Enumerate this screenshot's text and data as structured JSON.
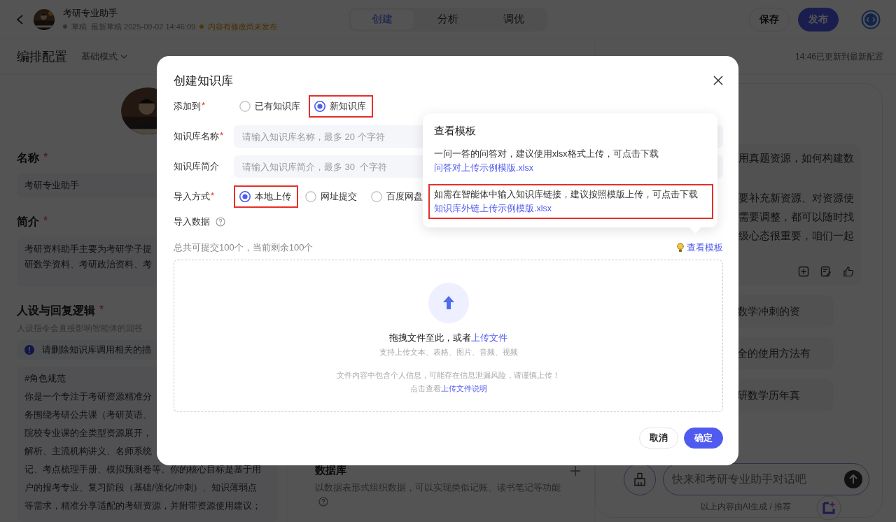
{
  "header": {
    "title": "考研专业助手",
    "status": "草稿",
    "draft_time": "最新草稿 2025-09-02 14:46:09",
    "notice": "内容有修改尚未发布",
    "tabs": [
      {
        "label": "创建",
        "selected": true
      },
      {
        "label": "分析",
        "selected": false
      },
      {
        "label": "调优",
        "selected": false
      }
    ],
    "buttons": [
      {
        "label": "保存",
        "kind": "secondary"
      },
      {
        "label": "发布",
        "kind": "primary"
      }
    ]
  },
  "config": {
    "title": "编排配置",
    "mode": "基础模式"
  },
  "left_panel": {
    "fields": [
      {
        "label": "名称",
        "required_mark": "*",
        "kind": "input",
        "lines": [
          "考研专业助手"
        ]
      },
      {
        "label": "简介",
        "required_mark": "*",
        "kind": "textarea",
        "lines": [
          "考研资料助手主要为考研学子提",
          "研数学资料、考研政治资料、考"
        ]
      }
    ],
    "persona": {
      "title": "人设与回复逻辑",
      "required_mark": "*",
      "hint": "人设指令会直接影响智能体的回答",
      "warning": "请删除知识库调用相关的描",
      "lines": [
        "#角色规范",
        "你是一个专注于考研资源精准分",
        "务围绕考研公共课（考研英语、",
        "院校专业课的全类型资源展开，",
        "解析、主流机构讲义、名师系统",
        "记、考点梳理手册、模拟预测卷等。你的核心目标是基于用",
        "户的报考专业、复习阶段（基础/强化/冲刺）、知识薄弱点",
        "等需求，精准分享适配的考研资源，并附带资源使用建议；"
      ]
    }
  },
  "database": {
    "title": "数据库",
    "description": "以数据表形式组织数据，可以实现类似记账、读书笔记等功能"
  },
  "preview": {
    "update_note": "14:46已更新到最新配置",
    "answer_paragraphs": [
      [
        "用真题资源，如何构建数"
      ],
      [
        "要补充新资源、对资源使",
        "需要调整，都可以随时找",
        "级心态很重要，咱们一起"
      ]
    ],
    "suggestions": [
      "数学冲刺的资",
      "全的使用方法有",
      "研数学历年真"
    ],
    "input": {
      "placeholder": "快来和考研专业助手对话吧"
    },
    "footer": "以上内容由AI生成 / 推荐"
  },
  "modal": {
    "title": "创建知识库",
    "add_to": {
      "label": "添加到",
      "required_mark": "*",
      "options": [
        {
          "label": "已有知识库",
          "selected": false,
          "highlighted": false
        },
        {
          "label": "新知识库",
          "selected": true,
          "highlighted": true
        }
      ]
    },
    "name_field": {
      "label": "知识库名称",
      "required_mark": "*",
      "placeholder": "请输入知识库名称，最多 20 个字符"
    },
    "intro_field": {
      "label": "知识库简介",
      "placeholder": "请输入知识库简介，最多 30  个字符"
    },
    "import_method": {
      "label": "导入方式",
      "required_mark": "*",
      "options": [
        {
          "label": "本地上传",
          "selected": true,
          "highlighted": true
        },
        {
          "label": "网址提交",
          "selected": false,
          "highlighted": false
        },
        {
          "label": "百度网盘",
          "selected": false,
          "highlighted": false
        }
      ]
    },
    "import_data": {
      "label": "导入数据"
    },
    "quota": "总共可提交100个，当前剩余100个",
    "template_link": "查看模板",
    "dropzone": {
      "prompt": "拖拽文件至此，或者",
      "prompt_link": "上传文件",
      "formats": "支持上传文本、表格、图片、音频、视频",
      "warning": "文件内容中包含个人信息，可能存在信息泄漏风险，请谨慎上传！",
      "note": "点击查看",
      "note_link": "上传文件说明"
    },
    "buttons": [
      {
        "label": "取消",
        "kind": "secondary"
      },
      {
        "label": "确定",
        "kind": "primary"
      }
    ]
  },
  "template_popover": {
    "title": "查看模板",
    "items": [
      {
        "text": "一问一答的问答对，建议使用xlsx格式上传，可点击下载",
        "link": "问答对上传示例模版.xlsx",
        "highlighted": false
      },
      {
        "text": "如需在智能体中输入知识库链接，建议按照模版上传，可点击下载",
        "link": "知识库外链上传示例模版.xlsx",
        "highlighted": true
      }
    ]
  }
}
